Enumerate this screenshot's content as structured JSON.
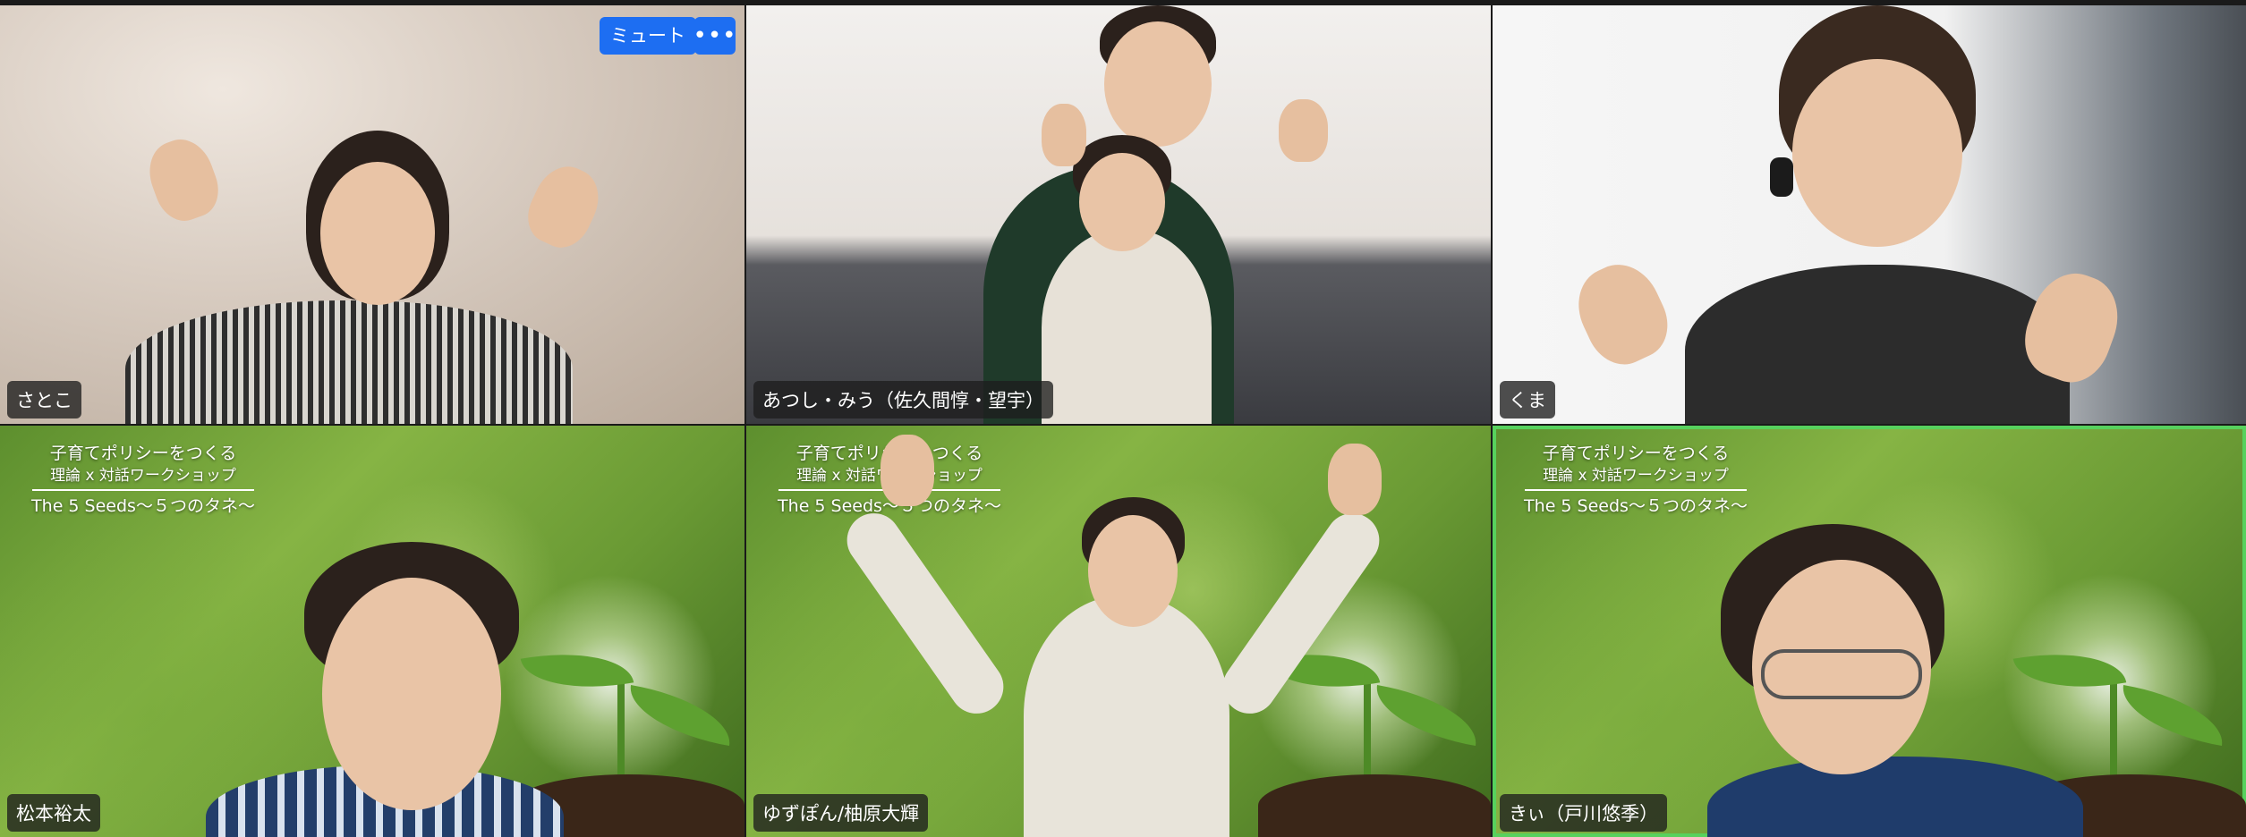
{
  "meeting": {
    "active_speaker": "きぃ（戸川悠季）"
  },
  "controls": {
    "mute_label": "ミュート",
    "more_icon": "more-horizontal-icon",
    "accent_color": "#1d6ef2",
    "active_border_color": "#57d15d"
  },
  "participants": [
    {
      "name": "さとこ"
    },
    {
      "name": "あつし・みう（佐久間惇・望宇）"
    },
    {
      "name": "くま"
    },
    {
      "name": "松本裕太",
      "bg_text": [
        "子育てポリシーをつくる",
        "理論 x 対話ワークショップ",
        "The 5 Seeds〜５つのタネ〜"
      ]
    },
    {
      "name": "ゆずぽん/柚原大輝",
      "bg_text": [
        "子育てポリシーをつくる",
        "理論 x 対話ワークショップ",
        "The 5 Seeds〜５つのタネ〜"
      ]
    },
    {
      "name": "きぃ（戸川悠季）",
      "bg_text": [
        "子育てポリシーをつくる",
        "理論 x 対話ワークショップ",
        "The 5 Seeds〜５つのタネ〜"
      ]
    }
  ]
}
